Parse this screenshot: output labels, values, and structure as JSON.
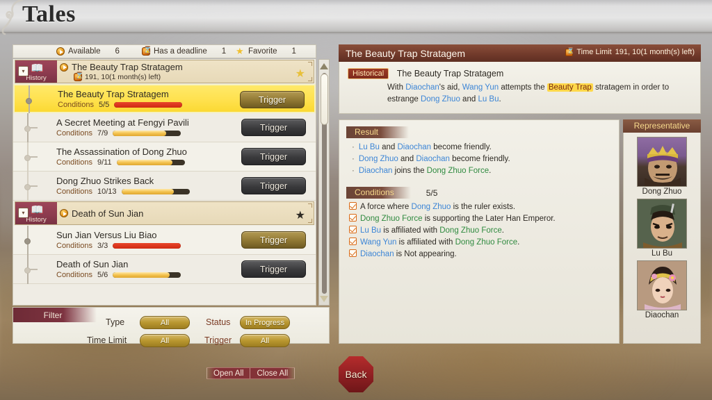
{
  "header": {
    "title": "Tales",
    "swirl_icon": "scroll-swirl-ornament"
  },
  "tally_bar": {
    "items": [
      {
        "icon": "available-play-icon",
        "label": "Available",
        "count": "6"
      },
      {
        "icon": "hourglass-deadline-icon",
        "label": "Has a deadline",
        "count": "1"
      },
      {
        "icon": "star-favorite-icon",
        "label": "Favorite",
        "count": "1"
      }
    ]
  },
  "quest_list": {
    "groups": [
      {
        "tag_label": "History",
        "tag_icon": "open-book-icon",
        "collapse_icon": "chevron-down-icon",
        "status_icon": "available-play-icon",
        "title": "The Beauty Trap Stratagem",
        "deadline_icon": "hourglass-deadline-icon",
        "deadline": "191, 10(1 month(s) left)",
        "favorite_icon": "star-favorite-icon",
        "favorite_state": "gold",
        "quests": [
          {
            "title": "The Beauty Trap Stratagem",
            "conditions_label": "Conditions",
            "conditions_value": "5/5",
            "progress_percent": 100,
            "progress_state": "full",
            "button_label": "Trigger",
            "button_state": "gold",
            "selected": true
          },
          {
            "title": "A Secret Meeting at Fengyi Pavili",
            "conditions_label": "Conditions",
            "conditions_value": "7/9",
            "progress_percent": 78,
            "progress_state": "part",
            "button_label": "Trigger",
            "button_state": "dark",
            "selected": false
          },
          {
            "title": "The Assassination of Dong Zhuo",
            "conditions_label": "Conditions",
            "conditions_value": "9/11",
            "progress_percent": 82,
            "progress_state": "part",
            "button_label": "Trigger",
            "button_state": "dark",
            "selected": false
          },
          {
            "title": "Dong Zhuo Strikes Back",
            "conditions_label": "Conditions",
            "conditions_value": "10/13",
            "progress_percent": 77,
            "progress_state": "part",
            "button_label": "Trigger",
            "button_state": "dark",
            "selected": false
          }
        ]
      },
      {
        "tag_label": "History",
        "tag_icon": "open-book-icon",
        "collapse_icon": "chevron-down-icon",
        "status_icon": "available-play-icon",
        "title": "Death of Sun Jian",
        "deadline_icon": null,
        "deadline": "",
        "favorite_icon": "star-favorite-icon",
        "favorite_state": "dark",
        "quests": [
          {
            "title": "Sun Jian Versus Liu Biao",
            "conditions_label": "Conditions",
            "conditions_value": "3/3",
            "progress_percent": 100,
            "progress_state": "full",
            "button_label": "Trigger",
            "button_state": "gold",
            "selected": false
          },
          {
            "title": "Death of Sun Jian",
            "conditions_label": "Conditions",
            "conditions_value": "5/6",
            "progress_percent": 83,
            "progress_state": "part",
            "button_label": "Trigger",
            "button_state": "dark",
            "selected": false
          }
        ]
      }
    ]
  },
  "scrollbar": {
    "up_arrow_icon": "triangle-up-icon",
    "down_arrow_icon": "triangle-down-icon"
  },
  "filter": {
    "tab_label": "Filter",
    "rows": [
      {
        "label": "Type",
        "value": "All",
        "label2": "Status",
        "value2": "In Progress"
      },
      {
        "label": "Time Limit",
        "value": "All",
        "label2": "Trigger",
        "value2": "All"
      }
    ]
  },
  "detail": {
    "title": "The Beauty Trap Stratagem",
    "time_limit_icon": "hourglass-deadline-icon",
    "time_limit_label": "Time Limit",
    "time_limit_value": "191, 10(1 month(s) left)",
    "badge": "Historical",
    "subtitle": "The Beauty Trap Stratagem",
    "body_parts": [
      {
        "text": "With ",
        "style": "plain"
      },
      {
        "text": "Diaochan",
        "style": "blue"
      },
      {
        "text": "'s aid, ",
        "style": "plain"
      },
      {
        "text": "Wang Yun",
        "style": "blue"
      },
      {
        "text": " attempts the ",
        "style": "plain"
      },
      {
        "text": "Beauty Trap",
        "style": "gold"
      },
      {
        "text": " stratagem in order to estrange ",
        "style": "plain"
      },
      {
        "text": "Dong Zhuo",
        "style": "blue"
      },
      {
        "text": " and ",
        "style": "plain"
      },
      {
        "text": "Lu Bu",
        "style": "blue"
      },
      {
        "text": ".",
        "style": "plain"
      }
    ]
  },
  "result": {
    "heading": "Result",
    "items": [
      [
        {
          "text": "Lu Bu",
          "style": "blue"
        },
        {
          "text": " and ",
          "style": "plain"
        },
        {
          "text": "Diaochan",
          "style": "blue"
        },
        {
          "text": " become friendly.",
          "style": "plain"
        }
      ],
      [
        {
          "text": "Dong Zhuo",
          "style": "blue"
        },
        {
          "text": " and ",
          "style": "plain"
        },
        {
          "text": "Diaochan",
          "style": "blue"
        },
        {
          "text": " become friendly.",
          "style": "plain"
        }
      ],
      [
        {
          "text": "Diaochan",
          "style": "blue"
        },
        {
          "text": " joins the ",
          "style": "plain"
        },
        {
          "text": "Dong Zhuo Force",
          "style": "green"
        },
        {
          "text": ".",
          "style": "plain"
        }
      ]
    ]
  },
  "conditions": {
    "heading": "Conditions",
    "count": "5/5",
    "items": [
      {
        "checked": true,
        "parts": [
          {
            "text": "A force where ",
            "style": "plain"
          },
          {
            "text": "Dong Zhuo",
            "style": "blue"
          },
          {
            "text": " is the ruler exists.",
            "style": "plain"
          }
        ]
      },
      {
        "checked": true,
        "parts": [
          {
            "text": "Dong Zhuo Force",
            "style": "green"
          },
          {
            "text": " is supporting the Later Han Emperor.",
            "style": "plain"
          }
        ]
      },
      {
        "checked": true,
        "parts": [
          {
            "text": "Lu Bu",
            "style": "blue"
          },
          {
            "text": " is affiliated with ",
            "style": "plain"
          },
          {
            "text": "Dong Zhuo Force",
            "style": "green"
          },
          {
            "text": ".",
            "style": "plain"
          }
        ]
      },
      {
        "checked": true,
        "parts": [
          {
            "text": "Wang Yun",
            "style": "blue"
          },
          {
            "text": " is affiliated with ",
            "style": "plain"
          },
          {
            "text": "Dong Zhuo Force",
            "style": "green"
          },
          {
            "text": ".",
            "style": "plain"
          }
        ]
      },
      {
        "checked": true,
        "parts": [
          {
            "text": "Diaochan",
            "style": "blue"
          },
          {
            "text": " is Not appearing.",
            "style": "plain"
          }
        ]
      }
    ]
  },
  "representative": {
    "heading": "Representative",
    "people": [
      {
        "name": "Dong Zhuo",
        "portrait": "p-dongzhuo"
      },
      {
        "name": "Lu Bu",
        "portrait": "p-lubu"
      },
      {
        "name": "Diaochan",
        "portrait": "p-diaochan"
      }
    ]
  },
  "footer": {
    "open_all": "Open All",
    "close_all": "Close All",
    "back": "Back"
  }
}
